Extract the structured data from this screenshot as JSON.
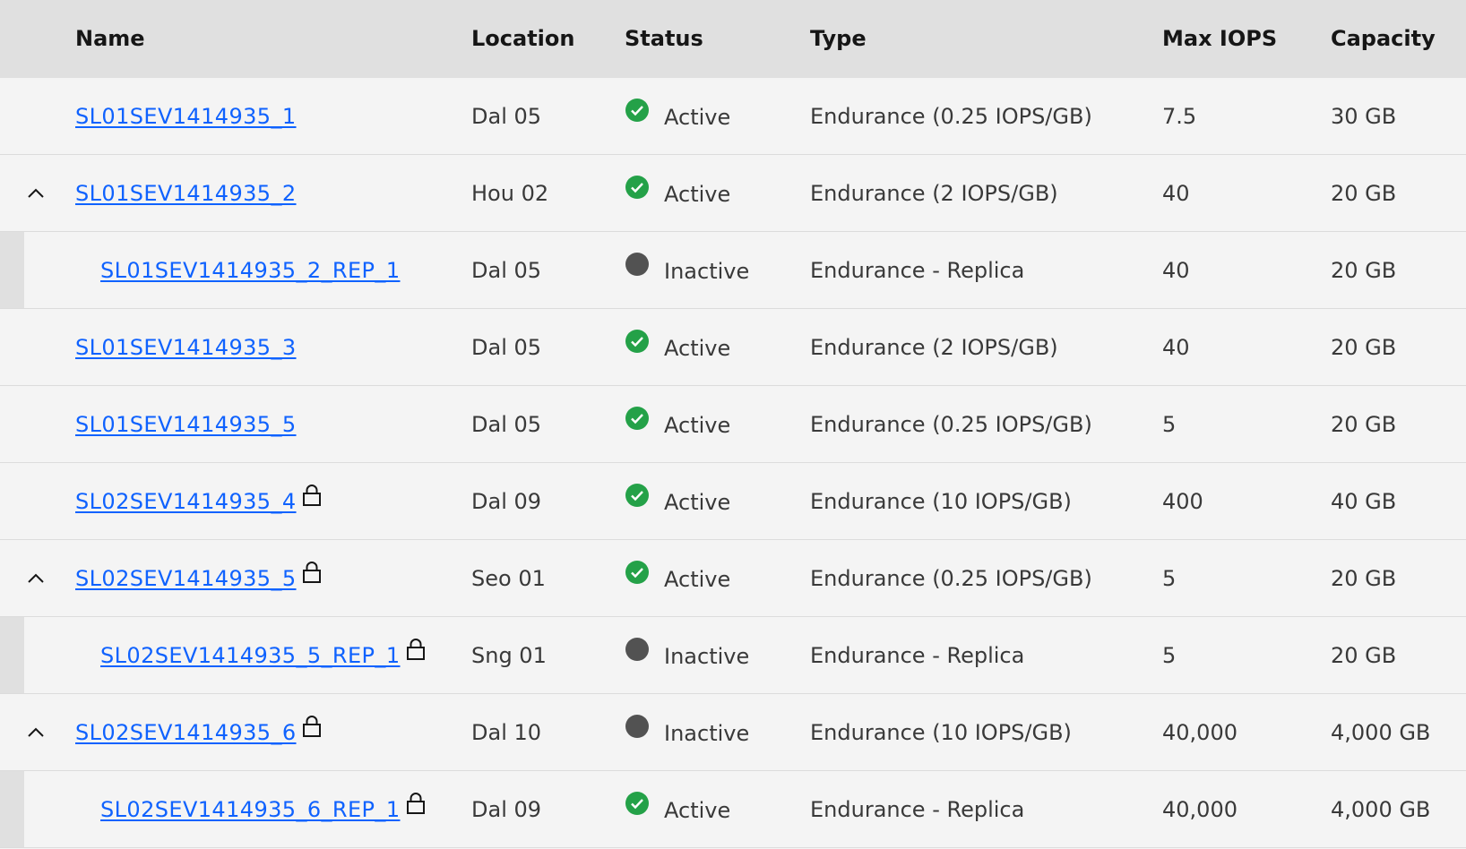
{
  "columns": {
    "name": "Name",
    "location": "Location",
    "status": "Status",
    "type": "Type",
    "max_iops": "Max IOPS",
    "capacity": "Capacity"
  },
  "colors": {
    "link": "#0f62fe",
    "active": "#24a148",
    "inactive": "#525252",
    "header_bg": "#e0e0e0",
    "row_bg": "#f4f4f4"
  },
  "rows": [
    {
      "name": "SL01SEV1414935_1",
      "location": "Dal 05",
      "status": "Active",
      "type": "Endurance (0.25 IOPS/GB)",
      "max_iops": "7.5",
      "capacity": "30 GB",
      "expandable": false,
      "child": false,
      "locked": false
    },
    {
      "name": "SL01SEV1414935_2",
      "location": "Hou 02",
      "status": "Active",
      "type": "Endurance (2 IOPS/GB)",
      "max_iops": "40",
      "capacity": "20 GB",
      "expandable": true,
      "child": false,
      "locked": false
    },
    {
      "name": "SL01SEV1414935_2_REP_1",
      "location": "Dal 05",
      "status": "Inactive",
      "type": "Endurance - Replica",
      "max_iops": "40",
      "capacity": "20 GB",
      "expandable": false,
      "child": true,
      "locked": false
    },
    {
      "name": "SL01SEV1414935_3",
      "location": "Dal 05",
      "status": "Active",
      "type": "Endurance (2 IOPS/GB)",
      "max_iops": "40",
      "capacity": "20 GB",
      "expandable": false,
      "child": false,
      "locked": false
    },
    {
      "name": "SL01SEV1414935_5",
      "location": "Dal 05",
      "status": "Active",
      "type": "Endurance (0.25 IOPS/GB)",
      "max_iops": "5",
      "capacity": "20 GB",
      "expandable": false,
      "child": false,
      "locked": false
    },
    {
      "name": "SL02SEV1414935_4",
      "location": "Dal 09",
      "status": "Active",
      "type": "Endurance (10 IOPS/GB)",
      "max_iops": "400",
      "capacity": "40 GB",
      "expandable": false,
      "child": false,
      "locked": true
    },
    {
      "name": "SL02SEV1414935_5",
      "location": "Seo 01",
      "status": "Active",
      "type": "Endurance (0.25 IOPS/GB)",
      "max_iops": "5",
      "capacity": "20 GB",
      "expandable": true,
      "child": false,
      "locked": true
    },
    {
      "name": "SL02SEV1414935_5_REP_1",
      "location": "Sng 01",
      "status": "Inactive",
      "type": "Endurance - Replica",
      "max_iops": "5",
      "capacity": "20 GB",
      "expandable": false,
      "child": true,
      "locked": true
    },
    {
      "name": "SL02SEV1414935_6",
      "location": "Dal 10",
      "status": "Inactive",
      "type": "Endurance (10 IOPS/GB)",
      "max_iops": "40,000",
      "capacity": "4,000 GB",
      "expandable": true,
      "child": false,
      "locked": true
    },
    {
      "name": "SL02SEV1414935_6_REP_1",
      "location": "Dal 09",
      "status": "Active",
      "type": "Endurance - Replica",
      "max_iops": "40,000",
      "capacity": "4,000 GB",
      "expandable": false,
      "child": true,
      "locked": true
    }
  ]
}
